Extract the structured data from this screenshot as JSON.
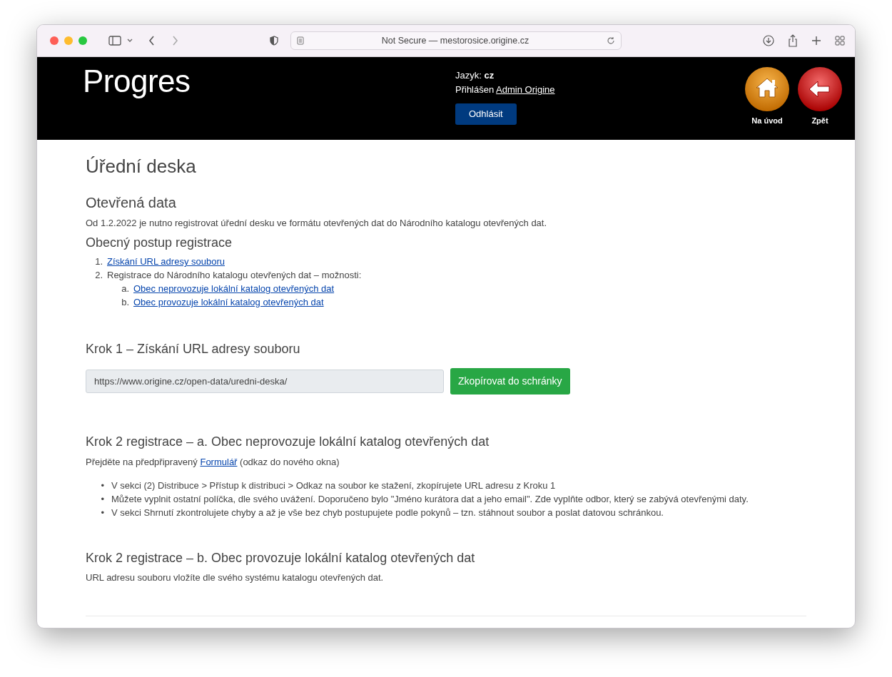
{
  "browser": {
    "address": "Not Secure — mestorosice.origine.cz"
  },
  "header": {
    "logo": "Progres",
    "language_label": "Jazyk:",
    "language": "cz",
    "logged_in_label": "Přihlášen",
    "user": "Admin Origine",
    "logout": "Odhlásit",
    "nav": [
      {
        "kind": "home",
        "label": "Na úvod"
      },
      {
        "kind": "back",
        "label": "Zpět"
      }
    ]
  },
  "title": "Úřední deska",
  "open_data": {
    "heading": "Otevřená data",
    "text": "Od 1.2.2022 je nutno registrovat úřední desku ve formátu otevřených dat do Národního katalogu otevřených dat."
  },
  "procedure": {
    "heading": "Obecný postup registrace",
    "steps": [
      {
        "marker": "1.",
        "kind": "link",
        "text": "Získání URL adresy souboru"
      },
      {
        "marker": "2.",
        "kind": "text",
        "text": "Registrace do Národního katalogu otevřených dat – možnosti:",
        "children": [
          {
            "marker": "a.",
            "kind": "link",
            "text": "Obec neprovozuje lokální katalog otevřených dat"
          },
          {
            "marker": "b.",
            "kind": "link",
            "text": "Obec provozuje lokální katalog otevřených dat"
          }
        ]
      }
    ]
  },
  "step1": {
    "heading": "Krok 1 – Získání URL adresy souboru",
    "url_field": "https://www.origine.cz/open-data/uredni-deska/",
    "copy_button": "Zkopírovat do schránky"
  },
  "step2a": {
    "heading": "Krok 2 registrace – a. Obec neprovozuje lokální katalog otevřených dat",
    "intro_before": "Přejděte na předpřipravený",
    "intro_link": "Formulář",
    "intro_after": "(odkaz do nového okna)",
    "bullets": [
      {
        "marker": "•",
        "text": "V sekci (2) Distribuce > Přístup k distribuci > Odkaz na soubor ke stažení, zkopírujete URL adresu z Kroku 1"
      },
      {
        "marker": "•",
        "text": "Můžete vyplnit ostatní políčka, dle svého uvážení. Doporučeno bylo \"Jméno kurátora dat a jeho email\". Zde vyplňte odbor, který se zabývá otevřenými daty."
      },
      {
        "marker": "•",
        "text": "V sekci Shrnutí zkontrolujete chyby a až je vše bez chyb postupujete podle pokynů – tzn. stáhnout soubor a poslat datovou schránkou."
      }
    ]
  },
  "step2b": {
    "heading": "Krok 2 registrace – b. Obec provozuje lokální katalog otevřených dat",
    "text": "URL adresu souboru vložíte dle svého systému katalogu otevřených dat."
  }
}
